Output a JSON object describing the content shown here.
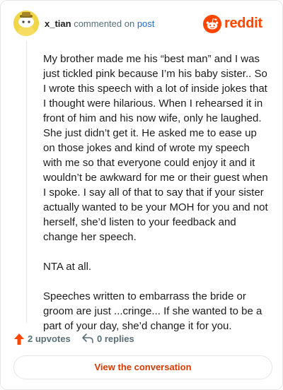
{
  "header": {
    "username": "x_tian",
    "action_text": "commented on",
    "post_link": "post",
    "brand_name": "reddit",
    "brand_color": "#ff4500"
  },
  "comment": {
    "paragraphs": [
      "My brother made me his “best man” and I was just tickled pink because I’m his baby sister.. So I wrote this speech with a lot of inside jokes that I thought were hilarious. When I rehearsed it in front of him and his now wife, only he laughed. She just didn’t get it. He asked me to ease up on those jokes and kind of wrote my speech with me so that everyone could enjoy it and it wouldn’t be awkward for me or their guest when I spoke. I say all of that to say that if your sister actually wanted to be your MOH for you and not herself, she’d listen to your feedback and change her speech.",
      "NTA at all.",
      "Speeches written to embarrass the bride or groom are just ...cringe... If she wanted to be a part of your day, she’d change it for you."
    ]
  },
  "actions": {
    "upvotes_label": "2 upvotes",
    "replies_label": "0 replies"
  },
  "cta": {
    "label": "View the conversation"
  },
  "icons": {
    "avatar": "snoo-avatar-icon",
    "brand": "reddit-logo-icon",
    "upvote": "upvote-arrow-icon",
    "reply": "reply-arrow-icon"
  }
}
